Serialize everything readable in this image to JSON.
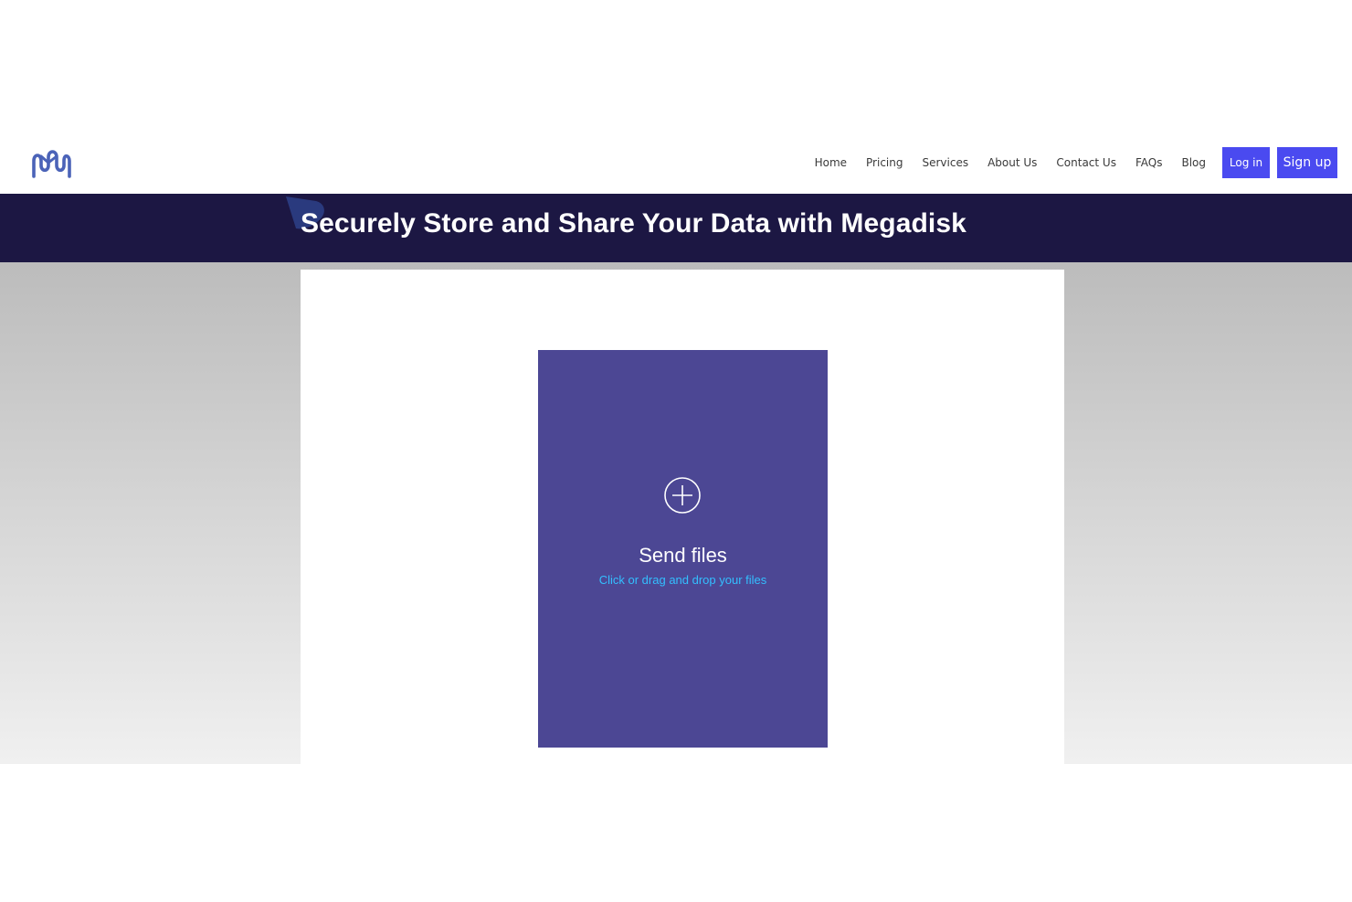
{
  "brand": {
    "logo_icon": "megadisk-m-logo-icon",
    "logo_color": "#4b63b8"
  },
  "nav": {
    "items": [
      {
        "label": "Home"
      },
      {
        "label": "Pricing"
      },
      {
        "label": "Services"
      },
      {
        "label": "About Us"
      },
      {
        "label": "Contact Us"
      },
      {
        "label": "FAQs"
      },
      {
        "label": "Blog"
      }
    ],
    "login_label": "Log in",
    "signup_label": "Sign up",
    "button_color": "#4a4af0"
  },
  "banner": {
    "title": "Securely Store and Share Your Data with Megadisk",
    "background": "#1c1743"
  },
  "upload": {
    "icon": "plus-circle-icon",
    "title": "Send files",
    "subtitle": "Click or drag and drop your files",
    "background": "#4c4794",
    "subtitle_color": "#33bfff"
  }
}
